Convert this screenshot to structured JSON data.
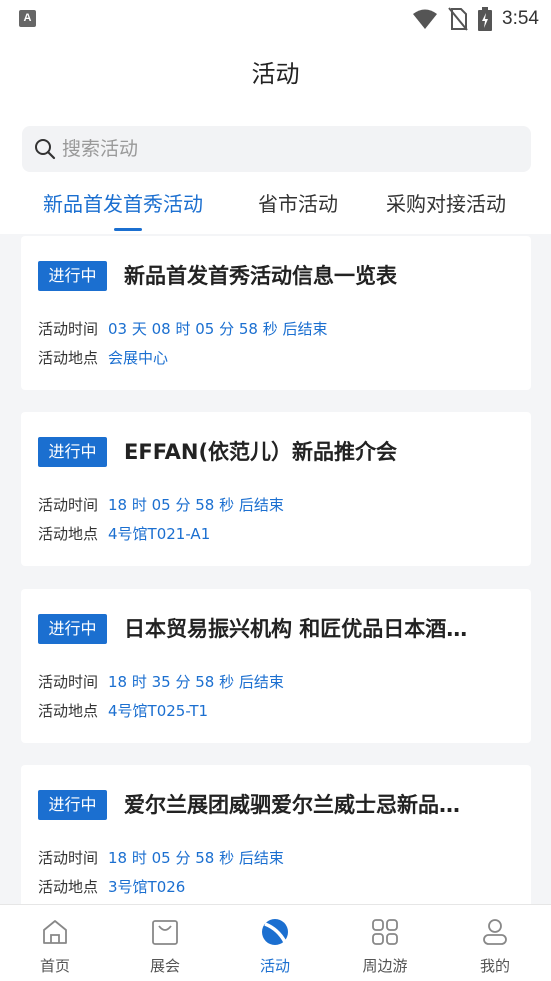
{
  "status_bar": {
    "time": "3:54",
    "app_indicator": "A"
  },
  "header": {
    "title": "活动"
  },
  "search": {
    "placeholder": "搜索活动"
  },
  "tabs": [
    {
      "label": "新品首发首秀活动",
      "active": true
    },
    {
      "label": "省市活动",
      "active": false
    },
    {
      "label": "采购对接活动",
      "active": false
    }
  ],
  "events": [
    {
      "status": "进行中",
      "title": "新品首发首秀活动信息一览表",
      "time_label": "活动时间",
      "time_value": "03 天 08 时 05 分 58 秒 后结束",
      "place_label": "活动地点",
      "place_value": "会展中心"
    },
    {
      "status": "进行中",
      "title": "EFFAN(依范儿）新品推介会",
      "time_label": "活动时间",
      "time_value": "18 时 05 分 58 秒 后结束",
      "place_label": "活动地点",
      "place_value": "4号馆T021-A1"
    },
    {
      "status": "进行中",
      "title": "日本贸易振兴机构 和匠优品日本酒…",
      "time_label": "活动时间",
      "time_value": "18 时 35 分 58 秒 后结束",
      "place_label": "活动地点",
      "place_value": "4号馆T025-T1"
    },
    {
      "status": "进行中",
      "title": "爱尔兰展团威驷爱尔兰威士忌新品…",
      "time_label": "活动时间",
      "time_value": "18 时 05 分 58 秒 后结束",
      "place_label": "活动地点",
      "place_value": "3号馆T026"
    }
  ],
  "tabbar": [
    {
      "label": "首页",
      "icon": "home-icon"
    },
    {
      "label": "展会",
      "icon": "bag-icon"
    },
    {
      "label": "活动",
      "icon": "activity-icon",
      "active": true
    },
    {
      "label": "周边游",
      "icon": "grid-icon"
    },
    {
      "label": "我的",
      "icon": "user-icon"
    }
  ],
  "colors": {
    "accent": "#1b6fd0",
    "background": "#f4f5f7"
  }
}
